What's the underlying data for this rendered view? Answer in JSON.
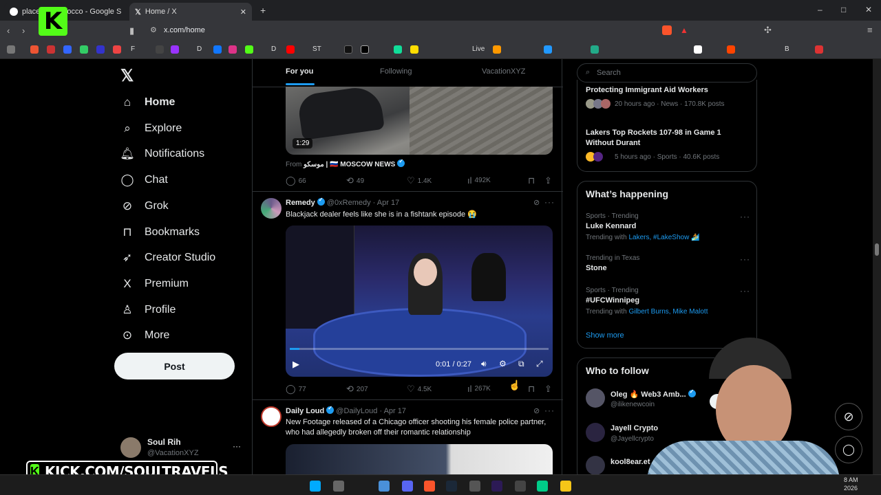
{
  "browser": {
    "tabs": [
      {
        "title": "places in Morocco - Google S",
        "active": false
      },
      {
        "title": "Home / X",
        "active": true
      }
    ],
    "new_tab": "+",
    "url": "x.com/home",
    "bookmarks": [
      "F",
      "D",
      "ST",
      "D",
      "Live",
      "B"
    ],
    "window_controls": [
      "–",
      "□",
      "✕"
    ]
  },
  "sidebar": {
    "items": [
      {
        "label": "Home",
        "icon": "home-icon",
        "glyph": "⌂"
      },
      {
        "label": "Explore",
        "icon": "search-icon",
        "glyph": "⌕"
      },
      {
        "label": "Notifications",
        "icon": "bell-icon",
        "glyph": "🔔︎"
      },
      {
        "label": "Chat",
        "icon": "chat-bubble-icon",
        "glyph": "◯"
      },
      {
        "label": "Grok",
        "icon": "grok-icon",
        "glyph": "⊘"
      },
      {
        "label": "Bookmarks",
        "icon": "bookmark-icon",
        "glyph": "⊓"
      },
      {
        "label": "Creator Studio",
        "icon": "rocket-icon",
        "glyph": "➶"
      },
      {
        "label": "Premium",
        "icon": "x-logo-icon",
        "glyph": "X"
      },
      {
        "label": "Profile",
        "icon": "person-icon",
        "glyph": "♙"
      },
      {
        "label": "More",
        "icon": "more-circle-icon",
        "glyph": "⊙"
      }
    ],
    "post_label": "Post",
    "account": {
      "name": "Soul Rih",
      "handle": "@VacationXYZ",
      "more": "···"
    }
  },
  "feed": {
    "tabs": [
      "For you",
      "Following",
      "VacationXYZ"
    ],
    "post1": {
      "duration": "1:29",
      "from_label": "From",
      "source": "موسكو | 🇷🇺 MOSCOW NEWS",
      "replies": "66",
      "reposts": "49",
      "likes": "1.4K",
      "views": "492K"
    },
    "post2": {
      "name": "Remedy",
      "handle": "@0xRemedy",
      "date": "Apr 17",
      "text": "Blackjack dealer feels like she is in a fishtank episode 😭",
      "time": "0:01 / 0:27",
      "replies": "77",
      "reposts": "207",
      "likes": "4.5K",
      "views": "267K"
    },
    "post3": {
      "name": "Daily Loud",
      "handle": "@DailyLoud",
      "date": "Apr 17",
      "text": "New Footage released of a Chicago officer shooting his female police partner, who had allegedly broken off their romantic relationship"
    }
  },
  "right": {
    "search_placeholder": "Search",
    "news": [
      {
        "title": "Protecting Immigrant Aid Workers",
        "meta": "20 hours ago · News · 170.8K posts"
      },
      {
        "title": "Lakers Top Rockets 107-98 in Game 1 Without Durant",
        "meta": "5 hours ago · Sports · 40.6K posts"
      }
    ],
    "whats_happening": "What’s happening",
    "trends": [
      {
        "meta": "Sports · Trending",
        "title": "Luke Kennard",
        "extra_prefix": "Trending with",
        "extra": "Lakers, #LakeShow 🏄"
      },
      {
        "meta": "Trending in Texas",
        "title": "Stone",
        "extra_prefix": "",
        "extra": ""
      },
      {
        "meta": "Sports · Trending",
        "title": "#UFCWinnipeg",
        "extra_prefix": "Trending with",
        "extra": "Gilbert Burns, Mike Malott"
      }
    ],
    "show_more": "Show more",
    "who_to_follow": "Who to follow",
    "follow": [
      {
        "name": "Oleg 🔥 Web3 Amb...",
        "handle": "@ilikenewcoin",
        "button": "Fo"
      },
      {
        "name": "Jayell Crypto",
        "handle": "@Jayellcrypto"
      },
      {
        "name": "kool8ear.et",
        "handle": ""
      }
    ]
  },
  "overlay": {
    "kick_text": "KICK.COM/SOULTRAVELS",
    "logo": "K"
  },
  "taskbar": {
    "clock_time": "8 AM",
    "clock_year": "2026"
  },
  "colors": {
    "accent": "#1d9bf0",
    "kick_green": "#53fc18"
  }
}
